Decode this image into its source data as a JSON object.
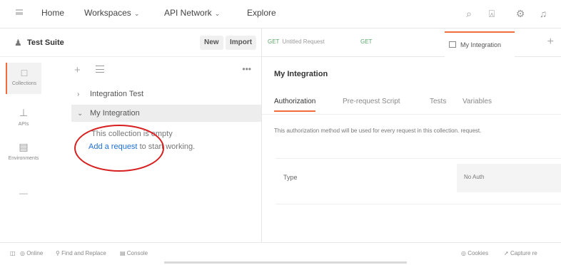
{
  "nav": {
    "home": "Home",
    "workspaces": "Workspaces",
    "api_network": "API Network",
    "explore": "Explore"
  },
  "icons": {
    "chevron": "⌄",
    "search": "⌕",
    "user": "⍓",
    "settings": "⚙",
    "bell": "♫"
  },
  "workspace": {
    "title": "Test Suite",
    "new_label": "New",
    "import_label": "Import"
  },
  "rail": [
    {
      "label": "Collections"
    },
    {
      "label": "APIs"
    },
    {
      "label": "Environments"
    },
    {
      "label": "—"
    }
  ],
  "tree": {
    "items": [
      {
        "label": "Integration Test",
        "arrow": "›"
      },
      {
        "label": "My Integration",
        "arrow": "⌄"
      }
    ],
    "empty_prefix": "This collection is empty",
    "add_link": "Add a request",
    "empty_suffix": "to start working."
  },
  "tabs": {
    "untitled_method": "GET",
    "untitled_label": "Untitled Request",
    "small_method": "GET",
    "active_label": "My Integration",
    "plus": "+"
  },
  "content": {
    "title": "My Integration",
    "subtabs": [
      "Authorization",
      "Pre-request Script",
      "Tests",
      "Variables"
    ],
    "description": "This authorization method will be used for every request in this collection. request.",
    "type_label": "Type",
    "type_value": "No Auth"
  },
  "footer": {
    "online": "Online",
    "find_replace": "Find and Replace",
    "console": "Console",
    "cookies": "Cookies",
    "capture": "Capture re"
  },
  "colors": {
    "accent": "#f26b3a",
    "link": "#1e6fd9",
    "annotation": "#d81f1f"
  }
}
